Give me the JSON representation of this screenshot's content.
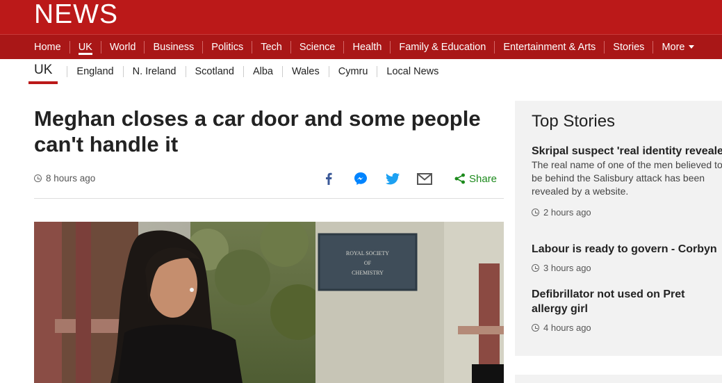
{
  "brand": {
    "logo": "NEWS"
  },
  "nav": {
    "items": [
      {
        "label": "Home"
      },
      {
        "label": "UK"
      },
      {
        "label": "World"
      },
      {
        "label": "Business"
      },
      {
        "label": "Politics"
      },
      {
        "label": "Tech"
      },
      {
        "label": "Science"
      },
      {
        "label": "Health"
      },
      {
        "label": "Family & Education"
      },
      {
        "label": "Entertainment & Arts"
      },
      {
        "label": "Stories"
      },
      {
        "label": "More"
      }
    ],
    "active": "UK"
  },
  "subnav": {
    "current": "UK",
    "items": [
      {
        "label": "England"
      },
      {
        "label": "N. Ireland"
      },
      {
        "label": "Scotland"
      },
      {
        "label": "Alba"
      },
      {
        "label": "Wales"
      },
      {
        "label": "Cymru"
      },
      {
        "label": "Local News"
      }
    ]
  },
  "article": {
    "headline": "Meghan closes a car door and some people can't handle it",
    "timestamp": "8 hours ago",
    "share_label": "Share",
    "hero_sign_text": "ROYAL SOCIETY OF CHEMISTRY"
  },
  "sidebar": {
    "title": "Top Stories",
    "stories": [
      {
        "title": "Skripal suspect 'real identity revealed'",
        "summary": "The real name of one of the men believed to be behind the Salisbury attack has been revealed by a website.",
        "time": "2 hours ago"
      },
      {
        "title": "Labour is ready to govern - Corbyn",
        "summary": "",
        "time": "3 hours ago"
      },
      {
        "title": "Defibrillator not used on Pret allergy girl",
        "summary": "",
        "time": "4 hours ago"
      }
    ]
  },
  "colors": {
    "brand_red": "#bb1919",
    "nav_red": "#a91717",
    "share_green": "#1c8a1c",
    "facebook_blue": "#3b5998",
    "messenger_blue": "#0084ff",
    "twitter_blue": "#1da1f2"
  },
  "icons": [
    "clock-icon",
    "facebook-icon",
    "messenger-icon",
    "twitter-icon",
    "email-icon",
    "share-icon",
    "chevron-down-icon"
  ]
}
